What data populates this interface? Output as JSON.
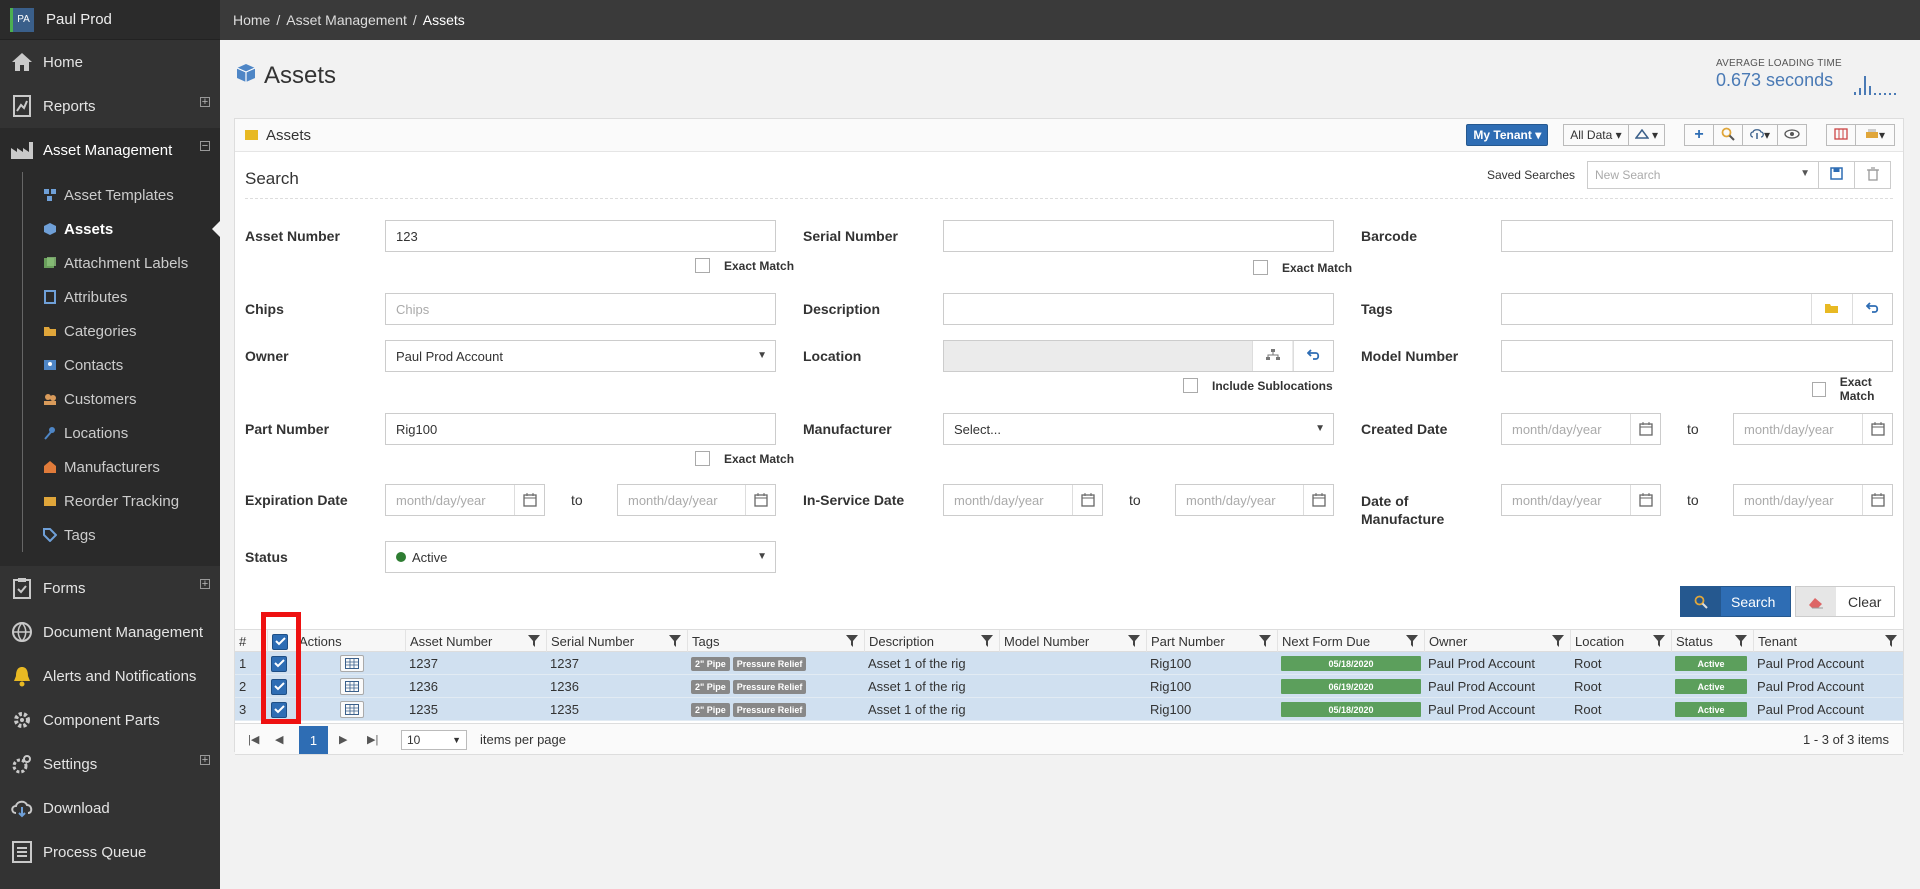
{
  "sidebar": {
    "avatar_initials": "PA",
    "user_name": "Paul Prod",
    "items": [
      {
        "label": "Home",
        "icon": "home-icon"
      },
      {
        "label": "Reports",
        "icon": "reports-icon"
      },
      {
        "label": "Asset Management",
        "icon": "factory-icon"
      },
      {
        "label": "Forms",
        "icon": "clipboard-icon"
      },
      {
        "label": "Document Management",
        "icon": "globe-icon"
      },
      {
        "label": "Alerts and Notifications",
        "icon": "bell-icon"
      },
      {
        "label": "Component Parts",
        "icon": "gear-icon"
      },
      {
        "label": "Settings",
        "icon": "settings-icon"
      },
      {
        "label": "Download",
        "icon": "cloud-download-icon"
      },
      {
        "label": "Process Queue",
        "icon": "queue-icon"
      }
    ],
    "sub_items": [
      {
        "label": "Asset Templates"
      },
      {
        "label": "Assets"
      },
      {
        "label": "Attachment Labels"
      },
      {
        "label": "Attributes"
      },
      {
        "label": "Categories"
      },
      {
        "label": "Contacts"
      },
      {
        "label": "Customers"
      },
      {
        "label": "Locations"
      },
      {
        "label": "Manufacturers"
      },
      {
        "label": "Reorder Tracking"
      },
      {
        "label": "Tags"
      }
    ]
  },
  "breadcrumb": {
    "home": "Home",
    "section": "Asset Management",
    "current": "Assets",
    "sep": "/"
  },
  "page": {
    "title": "Assets",
    "loading_label": "AVERAGE LOADING TIME",
    "loading_value": "0.673 seconds"
  },
  "panel": {
    "title": "Assets",
    "toolbar": {
      "tenant": "My Tenant",
      "all_data": "All Data"
    },
    "search_title": "Search",
    "saved_searches_label": "Saved Searches",
    "saved_searches_placeholder": "New Search"
  },
  "form": {
    "asset_number": {
      "label": "Asset Number",
      "value": "123"
    },
    "serial_number": {
      "label": "Serial Number",
      "value": ""
    },
    "barcode": {
      "label": "Barcode",
      "value": ""
    },
    "chips": {
      "label": "Chips",
      "placeholder": "Chips"
    },
    "description": {
      "label": "Description",
      "value": ""
    },
    "tags": {
      "label": "Tags",
      "value": ""
    },
    "owner": {
      "label": "Owner",
      "value": "Paul Prod Account"
    },
    "location": {
      "label": "Location",
      "value": ""
    },
    "model_number": {
      "label": "Model Number",
      "value": ""
    },
    "part_number": {
      "label": "Part Number",
      "value": "Rig100"
    },
    "manufacturer": {
      "label": "Manufacturer",
      "value": "Select..."
    },
    "created_date": {
      "label": "Created Date"
    },
    "expiration_date": {
      "label": "Expiration Date"
    },
    "in_service_date": {
      "label": "In-Service Date"
    },
    "date_of_manufacture": {
      "label": "Date of Manufacture"
    },
    "status": {
      "label": "Status",
      "value": "Active"
    },
    "exact_match": "Exact Match",
    "include_sublocations": "Include Sublocations",
    "date_placeholder": "month/day/year",
    "to": "to",
    "search_button": "Search",
    "clear_button": "Clear"
  },
  "grid": {
    "columns": [
      "#",
      "Actions",
      "Asset Number",
      "Serial Number",
      "Tags",
      "Description",
      "Model Number",
      "Part Number",
      "Next Form Due",
      "Owner",
      "Location",
      "Status",
      "Tenant"
    ],
    "rows": [
      {
        "num": "1",
        "asset_number": "1237",
        "serial_number": "1237",
        "tags": [
          "2\" Pipe",
          "Pressure Relief"
        ],
        "description": "Asset 1 of the rig",
        "model_number": "",
        "part_number": "Rig100",
        "next_form_due": "05/18/2020",
        "owner": "Paul Prod Account",
        "location": "Root",
        "status": "Active",
        "tenant": "Paul Prod Account"
      },
      {
        "num": "2",
        "asset_number": "1236",
        "serial_number": "1236",
        "tags": [
          "2\" Pipe",
          "Pressure Relief"
        ],
        "description": "Asset 1 of the rig",
        "model_number": "",
        "part_number": "Rig100",
        "next_form_due": "06/19/2020",
        "owner": "Paul Prod Account",
        "location": "Root",
        "status": "Active",
        "tenant": "Paul Prod Account"
      },
      {
        "num": "3",
        "asset_number": "1235",
        "serial_number": "1235",
        "tags": [
          "2\" Pipe",
          "Pressure Relief"
        ],
        "description": "Asset 1 of the rig",
        "model_number": "",
        "part_number": "Rig100",
        "next_form_due": "05/18/2020",
        "owner": "Paul Prod Account",
        "location": "Root",
        "status": "Active",
        "tenant": "Paul Prod Account"
      }
    ],
    "pager": {
      "current_page": "1",
      "page_size": "10",
      "items_per_page": "items per page",
      "info": "1 - 3 of 3 items"
    }
  },
  "colors": {
    "accent": "#2e6db4",
    "sidebar": "#333333",
    "status_green": "#5c9f5c",
    "highlight": "#ee1111"
  }
}
